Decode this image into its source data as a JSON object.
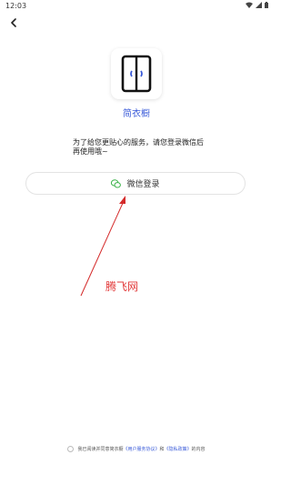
{
  "status_bar": {
    "time": "12:03"
  },
  "app": {
    "name": "简衣橱",
    "accent_color": "#3a5bd9",
    "logo_icon": "wardrobe-icon"
  },
  "intro_text": "为了给您更贴心的服务，请您登录微信后再使用哦~",
  "wechat_login": {
    "label": "微信登录",
    "icon": "wechat-icon",
    "icon_color": "#3cb34a"
  },
  "watermark_text": "腾飞网",
  "annotation_color": "#e23b3b",
  "agreement": {
    "prefix": "我已阅读并同意简衣橱",
    "user_agreement": "《用户服务协议》",
    "conjunction": "和",
    "privacy_policy": "《隐私政策》",
    "suffix": "的内容"
  }
}
